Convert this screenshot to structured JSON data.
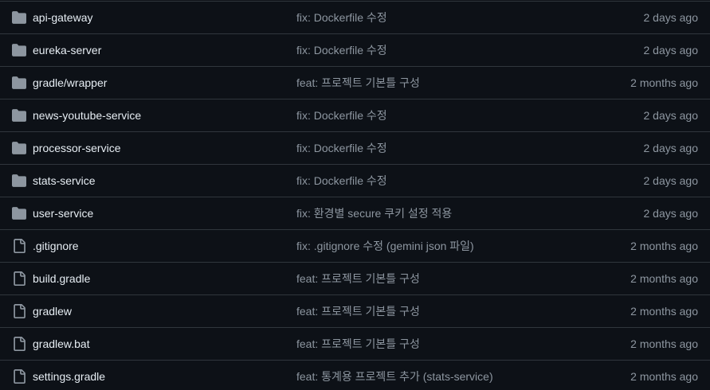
{
  "colors": {
    "background": "#0d1117",
    "border": "#30363d",
    "name_text": "#e6edf3",
    "muted_text": "#8d96a0",
    "icon": "#8d96a0"
  },
  "entries": [
    {
      "type": "directory",
      "icon": "folder-icon",
      "name": "api-gateway",
      "commit": "fix: Dockerfile 수정",
      "age": "2 days ago"
    },
    {
      "type": "directory",
      "icon": "folder-icon",
      "name": "eureka-server",
      "commit": "fix: Dockerfile 수정",
      "age": "2 days ago"
    },
    {
      "type": "directory",
      "icon": "folder-icon",
      "name": "gradle/wrapper",
      "commit": "feat: 프로젝트 기본틀 구성",
      "age": "2 months ago"
    },
    {
      "type": "directory",
      "icon": "folder-icon",
      "name": "news-youtube-service",
      "commit": "fix: Dockerfile 수정",
      "age": "2 days ago"
    },
    {
      "type": "directory",
      "icon": "folder-icon",
      "name": "processor-service",
      "commit": "fix: Dockerfile 수정",
      "age": "2 days ago"
    },
    {
      "type": "directory",
      "icon": "folder-icon",
      "name": "stats-service",
      "commit": "fix: Dockerfile 수정",
      "age": "2 days ago"
    },
    {
      "type": "directory",
      "icon": "folder-icon",
      "name": "user-service",
      "commit": "fix: 환경별 secure 쿠키 설정 적용",
      "age": "2 days ago"
    },
    {
      "type": "file",
      "icon": "file-icon",
      "name": ".gitignore",
      "commit": "fix: .gitignore 수정 (gemini json 파일)",
      "age": "2 months ago"
    },
    {
      "type": "file",
      "icon": "file-icon",
      "name": "build.gradle",
      "commit": "feat: 프로젝트 기본틀 구성",
      "age": "2 months ago"
    },
    {
      "type": "file",
      "icon": "file-icon",
      "name": "gradlew",
      "commit": "feat: 프로젝트 기본틀 구성",
      "age": "2 months ago"
    },
    {
      "type": "file",
      "icon": "file-icon",
      "name": "gradlew.bat",
      "commit": "feat: 프로젝트 기본틀 구성",
      "age": "2 months ago"
    },
    {
      "type": "file",
      "icon": "file-icon",
      "name": "settings.gradle",
      "commit": "feat: 통계용 프로젝트 추가 (stats-service)",
      "age": "2 months ago"
    }
  ]
}
